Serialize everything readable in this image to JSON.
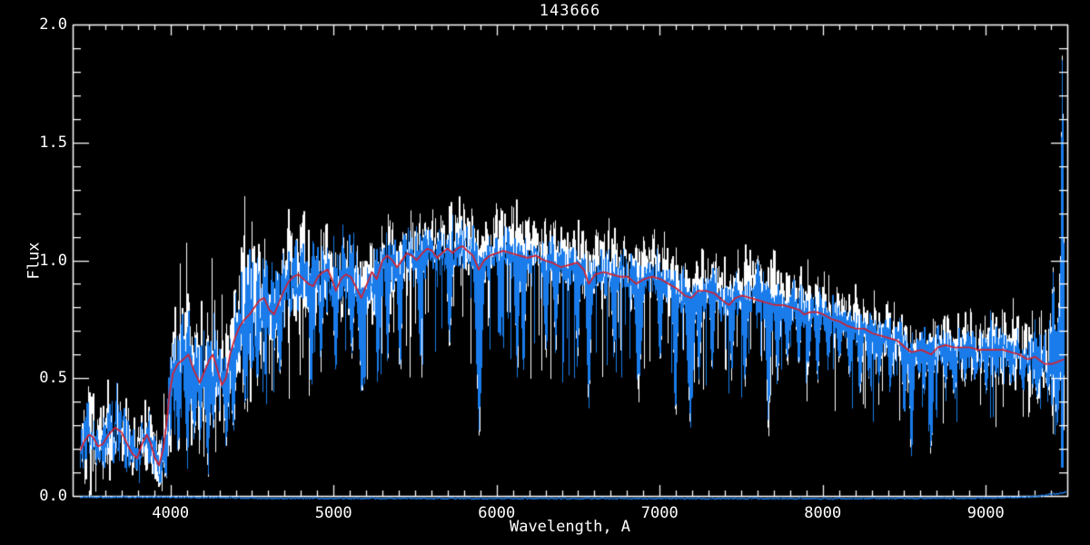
{
  "chart": {
    "title": "143666",
    "xlabel": "Wavelength, A",
    "ylabel": "Flux"
  },
  "axes": {
    "x_tick_labels": [
      "4000",
      "5000",
      "6000",
      "7000",
      "8000",
      "9000"
    ],
    "x_tick_values": [
      4000,
      5000,
      6000,
      7000,
      8000,
      9000
    ],
    "y_tick_labels": [
      "2.0",
      "1.5",
      "1.0",
      "0.5",
      "0.0"
    ],
    "y_tick_values": [
      2.0,
      1.5,
      1.0,
      0.5,
      0.0
    ]
  },
  "colors": {
    "background": "#000000",
    "axis": "#ffffff",
    "observed_raw": "#ffffff",
    "observed": "#1a7ceb",
    "model": "#d81f2c"
  },
  "chart_data": {
    "type": "line",
    "title": "143666",
    "xlabel": "Wavelength, A",
    "ylabel": "Flux",
    "xlim": [
      3400,
      9500
    ],
    "ylim": [
      0.0,
      2.0
    ],
    "x_minor_step": 100,
    "y_minor_step": 0.1,
    "grid": false,
    "legend": "none",
    "data_range": [
      3445,
      9480
    ],
    "seed": 7,
    "series": [
      {
        "name": "observed-raw-spectrum",
        "color": "#ffffff",
        "style": "noisy",
        "derived_from": "model_points"
      },
      {
        "name": "observed-spectrum",
        "color": "#1a7ceb",
        "style": "noisy",
        "derived_from": "model_points"
      },
      {
        "name": "model-fit",
        "color": "#d81f2c",
        "style": "smooth",
        "points": "model_points"
      },
      {
        "name": "error-spectrum",
        "color": "#1a7ceb",
        "style": "flat-bottom",
        "points": "error_points"
      }
    ],
    "model_points": [
      [
        3445,
        0.19
      ],
      [
        3470,
        0.23
      ],
      [
        3500,
        0.26
      ],
      [
        3525,
        0.25
      ],
      [
        3555,
        0.21
      ],
      [
        3585,
        0.22
      ],
      [
        3620,
        0.26
      ],
      [
        3660,
        0.29
      ],
      [
        3700,
        0.27
      ],
      [
        3735,
        0.22
      ],
      [
        3765,
        0.18
      ],
      [
        3795,
        0.16
      ],
      [
        3825,
        0.22
      ],
      [
        3855,
        0.26
      ],
      [
        3880,
        0.22
      ],
      [
        3905,
        0.16
      ],
      [
        3930,
        0.13
      ],
      [
        3955,
        0.2
      ],
      [
        3975,
        0.3
      ],
      [
        3995,
        0.44
      ],
      [
        4015,
        0.52
      ],
      [
        4045,
        0.56
      ],
      [
        4080,
        0.58
      ],
      [
        4110,
        0.6
      ],
      [
        4145,
        0.53
      ],
      [
        4180,
        0.48
      ],
      [
        4215,
        0.54
      ],
      [
        4240,
        0.58
      ],
      [
        4260,
        0.6
      ],
      [
        4290,
        0.53
      ],
      [
        4315,
        0.47
      ],
      [
        4340,
        0.5
      ],
      [
        4365,
        0.6
      ],
      [
        4395,
        0.67
      ],
      [
        4425,
        0.72
      ],
      [
        4455,
        0.75
      ],
      [
        4485,
        0.77
      ],
      [
        4515,
        0.8
      ],
      [
        4545,
        0.83
      ],
      [
        4575,
        0.84
      ],
      [
        4605,
        0.79
      ],
      [
        4635,
        0.77
      ],
      [
        4665,
        0.82
      ],
      [
        4695,
        0.87
      ],
      [
        4725,
        0.91
      ],
      [
        4755,
        0.93
      ],
      [
        4785,
        0.94
      ],
      [
        4815,
        0.92
      ],
      [
        4845,
        0.9
      ],
      [
        4875,
        0.89
      ],
      [
        4905,
        0.93
      ],
      [
        4935,
        0.95
      ],
      [
        4965,
        0.96
      ],
      [
        4990,
        0.92
      ],
      [
        5015,
        0.87
      ],
      [
        5045,
        0.92
      ],
      [
        5075,
        0.94
      ],
      [
        5105,
        0.93
      ],
      [
        5135,
        0.89
      ],
      [
        5170,
        0.84
      ],
      [
        5205,
        0.9
      ],
      [
        5235,
        0.95
      ],
      [
        5265,
        0.92
      ],
      [
        5300,
        1.0
      ],
      [
        5330,
        1.02
      ],
      [
        5360,
        1.0
      ],
      [
        5390,
        0.97
      ],
      [
        5420,
        1.0
      ],
      [
        5450,
        1.03
      ],
      [
        5480,
        1.02
      ],
      [
        5510,
        1.0
      ],
      [
        5545,
        1.03
      ],
      [
        5575,
        1.05
      ],
      [
        5605,
        1.04
      ],
      [
        5635,
        1.01
      ],
      [
        5665,
        1.03
      ],
      [
        5700,
        1.05
      ],
      [
        5730,
        1.03
      ],
      [
        5760,
        1.05
      ],
      [
        5790,
        1.06
      ],
      [
        5820,
        1.04
      ],
      [
        5855,
        1.02
      ],
      [
        5890,
        0.96
      ],
      [
        5925,
        1.0
      ],
      [
        5960,
        1.02
      ],
      [
        6000,
        1.03
      ],
      [
        6040,
        1.04
      ],
      [
        6090,
        1.03
      ],
      [
        6140,
        1.02
      ],
      [
        6190,
        1.01
      ],
      [
        6240,
        1.02
      ],
      [
        6290,
        1.0
      ],
      [
        6340,
        0.99
      ],
      [
        6395,
        0.97
      ],
      [
        6445,
        0.98
      ],
      [
        6495,
        0.99
      ],
      [
        6535,
        0.96
      ],
      [
        6565,
        0.9
      ],
      [
        6605,
        0.94
      ],
      [
        6655,
        0.95
      ],
      [
        6705,
        0.94
      ],
      [
        6755,
        0.93
      ],
      [
        6805,
        0.93
      ],
      [
        6855,
        0.9
      ],
      [
        6905,
        0.92
      ],
      [
        6955,
        0.93
      ],
      [
        7005,
        0.92
      ],
      [
        7055,
        0.9
      ],
      [
        7105,
        0.88
      ],
      [
        7155,
        0.85
      ],
      [
        7195,
        0.84
      ],
      [
        7235,
        0.87
      ],
      [
        7285,
        0.87
      ],
      [
        7335,
        0.86
      ],
      [
        7385,
        0.83
      ],
      [
        7425,
        0.81
      ],
      [
        7465,
        0.84
      ],
      [
        7505,
        0.85
      ],
      [
        7555,
        0.84
      ],
      [
        7605,
        0.83
      ],
      [
        7655,
        0.82
      ],
      [
        7705,
        0.81
      ],
      [
        7755,
        0.81
      ],
      [
        7805,
        0.8
      ],
      [
        7855,
        0.79
      ],
      [
        7885,
        0.77
      ],
      [
        7925,
        0.78
      ],
      [
        7965,
        0.78
      ],
      [
        8005,
        0.77
      ],
      [
        8055,
        0.75
      ],
      [
        8105,
        0.74
      ],
      [
        8155,
        0.72
      ],
      [
        8205,
        0.71
      ],
      [
        8255,
        0.71
      ],
      [
        8305,
        0.69
      ],
      [
        8355,
        0.68
      ],
      [
        8405,
        0.67
      ],
      [
        8455,
        0.66
      ],
      [
        8505,
        0.63
      ],
      [
        8545,
        0.61
      ],
      [
        8605,
        0.62
      ],
      [
        8665,
        0.6
      ],
      [
        8705,
        0.63
      ],
      [
        8755,
        0.64
      ],
      [
        8805,
        0.63
      ],
      [
        8855,
        0.63
      ],
      [
        8905,
        0.63
      ],
      [
        8955,
        0.62
      ],
      [
        9005,
        0.62
      ],
      [
        9055,
        0.62
      ],
      [
        9105,
        0.62
      ],
      [
        9155,
        0.61
      ],
      [
        9205,
        0.6
      ],
      [
        9255,
        0.58
      ],
      [
        9305,
        0.59
      ],
      [
        9360,
        0.56
      ],
      [
        9405,
        0.56
      ],
      [
        9445,
        0.57
      ],
      [
        9480,
        0.58
      ]
    ],
    "absorption_lines": [
      [
        3934,
        0.04,
        2
      ],
      [
        3969,
        0.06,
        2
      ],
      [
        4046,
        0.18,
        2
      ],
      [
        4101,
        0.15,
        2
      ],
      [
        4144,
        0.25,
        2
      ],
      [
        4227,
        0.1,
        2
      ],
      [
        4260,
        0.3,
        2
      ],
      [
        4340,
        0.22,
        2
      ],
      [
        4383,
        0.28,
        2
      ],
      [
        4455,
        0.35,
        2
      ],
      [
        4530,
        0.45,
        2
      ],
      [
        4668,
        0.5,
        2
      ],
      [
        4861,
        0.45,
        2
      ],
      [
        4920,
        0.58,
        2
      ],
      [
        5010,
        0.55,
        2
      ],
      [
        5110,
        0.6,
        2
      ],
      [
        5172,
        0.45,
        3
      ],
      [
        5270,
        0.5,
        2
      ],
      [
        5330,
        0.6,
        2
      ],
      [
        5405,
        0.55,
        2
      ],
      [
        5530,
        0.6,
        2
      ],
      [
        5710,
        0.62,
        2
      ],
      [
        5890,
        0.3,
        3
      ],
      [
        6020,
        0.65,
        2
      ],
      [
        6122,
        0.55,
        2
      ],
      [
        6162,
        0.55,
        2
      ],
      [
        6300,
        0.6,
        2
      ],
      [
        6360,
        0.62,
        2
      ],
      [
        6494,
        0.58,
        2
      ],
      [
        6563,
        0.38,
        2
      ],
      [
        6717,
        0.6,
        2
      ],
      [
        6870,
        0.45,
        3
      ],
      [
        7000,
        0.55,
        2
      ],
      [
        7094,
        0.35,
        2
      ],
      [
        7187,
        0.3,
        3
      ],
      [
        7240,
        0.5,
        2
      ],
      [
        7320,
        0.55,
        2
      ],
      [
        7440,
        0.52,
        2
      ],
      [
        7520,
        0.48,
        2
      ],
      [
        7665,
        0.3,
        2
      ],
      [
        7720,
        0.5,
        2
      ],
      [
        7780,
        0.55,
        2
      ],
      [
        7850,
        0.55,
        2
      ],
      [
        7910,
        0.52,
        2
      ],
      [
        7966,
        0.5,
        2
      ],
      [
        8030,
        0.55,
        2
      ],
      [
        8100,
        0.57,
        2
      ],
      [
        8164,
        0.5,
        2
      ],
      [
        8227,
        0.42,
        2
      ],
      [
        8280,
        0.52,
        2
      ],
      [
        8344,
        0.48,
        2
      ],
      [
        8412,
        0.45,
        2
      ],
      [
        8498,
        0.35,
        2
      ],
      [
        8542,
        0.16,
        2
      ],
      [
        8590,
        0.5,
        2
      ],
      [
        8620,
        0.45,
        2
      ],
      [
        8662,
        0.2,
        2
      ],
      [
        8750,
        0.45,
        2
      ],
      [
        8806,
        0.4,
        2
      ],
      [
        8870,
        0.48,
        2
      ],
      [
        8930,
        0.5,
        2
      ],
      [
        9000,
        0.45,
        2
      ],
      [
        9060,
        0.5,
        2
      ],
      [
        9150,
        0.48,
        2
      ],
      [
        9226,
        0.45,
        2
      ],
      [
        9310,
        0.42,
        2
      ],
      [
        9380,
        0.45,
        2
      ],
      [
        9435,
        0.3,
        2
      ]
    ],
    "emission_spikes": [
      [
        7600,
        1.0,
        3
      ],
      [
        7612,
        0.92,
        2
      ],
      [
        9411,
        0.95,
        2
      ],
      [
        9445,
        0.8,
        2
      ],
      [
        9467,
        1.85,
        2
      ]
    ],
    "noise_sigma_points": [
      [
        3445,
        0.28
      ],
      [
        3900,
        0.26
      ],
      [
        4000,
        0.22
      ],
      [
        4400,
        0.18
      ],
      [
        4700,
        0.1
      ],
      [
        5200,
        0.07
      ],
      [
        5600,
        0.05
      ],
      [
        6500,
        0.05
      ],
      [
        7500,
        0.055
      ],
      [
        8300,
        0.06
      ],
      [
        8800,
        0.07
      ],
      [
        9100,
        0.09
      ],
      [
        9300,
        0.11
      ],
      [
        9480,
        0.16
      ]
    ],
    "white_offset_points": [
      [
        3400,
        0.0
      ],
      [
        5450,
        0.005
      ],
      [
        5650,
        0.045
      ],
      [
        8200,
        0.045
      ],
      [
        8500,
        0.015
      ],
      [
        9000,
        0.01
      ],
      [
        9480,
        0.01
      ]
    ],
    "error_points": [
      [
        3445,
        0.01
      ],
      [
        4000,
        0.01
      ],
      [
        4300,
        0.008
      ],
      [
        4600,
        0.005
      ],
      [
        8000,
        0.004
      ],
      [
        9000,
        0.006
      ],
      [
        9300,
        0.012
      ],
      [
        9480,
        0.03
      ]
    ]
  }
}
